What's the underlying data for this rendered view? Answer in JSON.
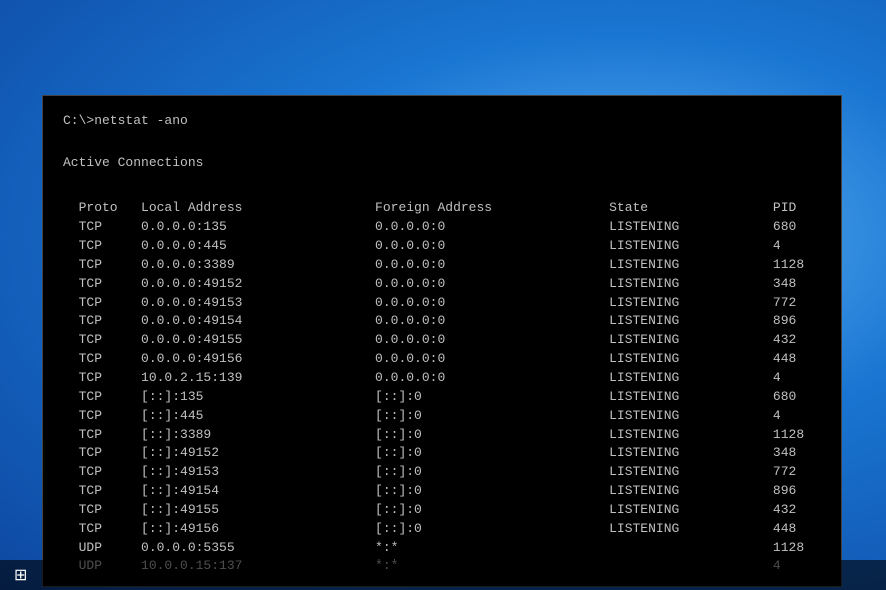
{
  "desktop": {
    "taskbar": {
      "start_icon": "⊞"
    }
  },
  "terminal": {
    "command": "C:\\>netstat -ano",
    "title": "Active Connections",
    "columns": {
      "proto": "Proto",
      "local": "Local Address",
      "foreign": "Foreign Address",
      "state": "State",
      "pid": "PID"
    },
    "rows": [
      {
        "proto": "TCP",
        "local": "0.0.0.0:135",
        "foreign": "0.0.0.0:0",
        "state": "LISTENING",
        "pid": "680"
      },
      {
        "proto": "TCP",
        "local": "0.0.0.0:445",
        "foreign": "0.0.0.0:0",
        "state": "LISTENING",
        "pid": "4"
      },
      {
        "proto": "TCP",
        "local": "0.0.0.0:3389",
        "foreign": "0.0.0.0:0",
        "state": "LISTENING",
        "pid": "1128"
      },
      {
        "proto": "TCP",
        "local": "0.0.0.0:49152",
        "foreign": "0.0.0.0:0",
        "state": "LISTENING",
        "pid": "348"
      },
      {
        "proto": "TCP",
        "local": "0.0.0.0:49153",
        "foreign": "0.0.0.0:0",
        "state": "LISTENING",
        "pid": "772"
      },
      {
        "proto": "TCP",
        "local": "0.0.0.0:49154",
        "foreign": "0.0.0.0:0",
        "state": "LISTENING",
        "pid": "896"
      },
      {
        "proto": "TCP",
        "local": "0.0.0.0:49155",
        "foreign": "0.0.0.0:0",
        "state": "LISTENING",
        "pid": "432"
      },
      {
        "proto": "TCP",
        "local": "0.0.0.0:49156",
        "foreign": "0.0.0.0:0",
        "state": "LISTENING",
        "pid": "448"
      },
      {
        "proto": "TCP",
        "local": "10.0.2.15:139",
        "foreign": "0.0.0.0:0",
        "state": "LISTENING",
        "pid": "4"
      },
      {
        "proto": "TCP",
        "local": "[::]:135",
        "foreign": "[::]·0",
        "state": "LISTENING",
        "pid": "680"
      },
      {
        "proto": "TCP",
        "local": "[::]:445",
        "foreign": "[::]·0",
        "state": "LISTENING",
        "pid": "4"
      },
      {
        "proto": "TCP",
        "local": "[::]:3389",
        "foreign": "[::]·0",
        "state": "LISTENING",
        "pid": "1128"
      },
      {
        "proto": "TCP",
        "local": "[::]:49152",
        "foreign": "[::]·0",
        "state": "LISTENING",
        "pid": "348"
      },
      {
        "proto": "TCP",
        "local": "[::]:49153",
        "foreign": "[::]·0",
        "state": "LISTENING",
        "pid": "772"
      },
      {
        "proto": "TCP",
        "local": "[::]:49154",
        "foreign": "[::]·0",
        "state": "LISTENING",
        "pid": "896"
      },
      {
        "proto": "TCP",
        "local": "[::]:49155",
        "foreign": "[::]·0",
        "state": "LISTENING",
        "pid": "432"
      },
      {
        "proto": "TCP",
        "local": "[::]:49156",
        "foreign": "[::]·0",
        "state": "LISTENING",
        "pid": "448"
      },
      {
        "proto": "UDP",
        "local": "0.0.0.0:5355",
        "foreign": "*:*",
        "state": "",
        "pid": "1128"
      },
      {
        "proto": "UDP",
        "local": "10.0.0.15:137",
        "foreign": "*:*",
        "state": "",
        "pid": "4"
      }
    ]
  }
}
